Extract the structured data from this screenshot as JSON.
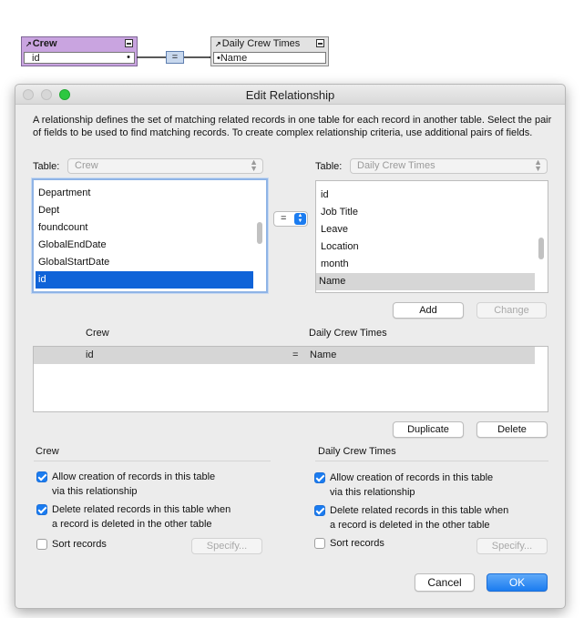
{
  "graph": {
    "left_table": {
      "name": "Crew",
      "field": "id"
    },
    "right_table": {
      "name": "Daily Crew Times",
      "field": "Name"
    },
    "operator": "="
  },
  "dialog": {
    "title": "Edit Relationship",
    "description": "A relationship defines the set of matching related records in one table for each record in another table. Select the pair of fields to be used to find matching records. To create complex relationship criteria, use additional pairs of fields.",
    "left": {
      "table_label": "Table:",
      "table_value": "Crew",
      "fields": [
        "Department",
        "Dept",
        "foundcount",
        "GlobalEndDate",
        "GlobalStartDate",
        "id"
      ],
      "selected_field": "id"
    },
    "operator": "=",
    "right": {
      "table_label": "Table:",
      "table_value": "Daily Crew Times",
      "fields": [
        "id",
        "Job Title",
        "Leave",
        "Location",
        "month",
        "Name"
      ],
      "selected_field": "Name"
    },
    "buttons": {
      "add": "Add",
      "change": "Change",
      "duplicate": "Duplicate",
      "delete": "Delete",
      "cancel": "Cancel",
      "ok": "OK",
      "specify_left": "Specify...",
      "specify_right": "Specify..."
    },
    "criteria": {
      "headers": {
        "left": "Crew",
        "right": "Daily Crew Times"
      },
      "rows": [
        {
          "left": "id",
          "op": "=",
          "right": "Name"
        }
      ]
    },
    "options": {
      "left": {
        "header": "Crew",
        "allow_creation": {
          "line1": "Allow creation of records in this table",
          "line2": "via this relationship",
          "checked": true
        },
        "delete_related": {
          "line1": "Delete related records in this table when",
          "line2": "a record is deleted in the other table",
          "checked": true
        },
        "sort": {
          "label": "Sort records",
          "checked": false
        }
      },
      "right": {
        "header": "Daily Crew Times",
        "allow_creation": {
          "line1": "Allow creation of records in this table",
          "line2": "via this relationship",
          "checked": true
        },
        "delete_related": {
          "line1": "Delete related records in this table when",
          "line2": "a record is deleted in the other table",
          "checked": true
        },
        "sort": {
          "label": "Sort records",
          "checked": false
        }
      }
    }
  },
  "colors": {
    "crew_header": "#c9a4e0",
    "dct_header": "#e2e2e2",
    "selection": "#0f63d8",
    "accent": "#1b7cf0"
  }
}
